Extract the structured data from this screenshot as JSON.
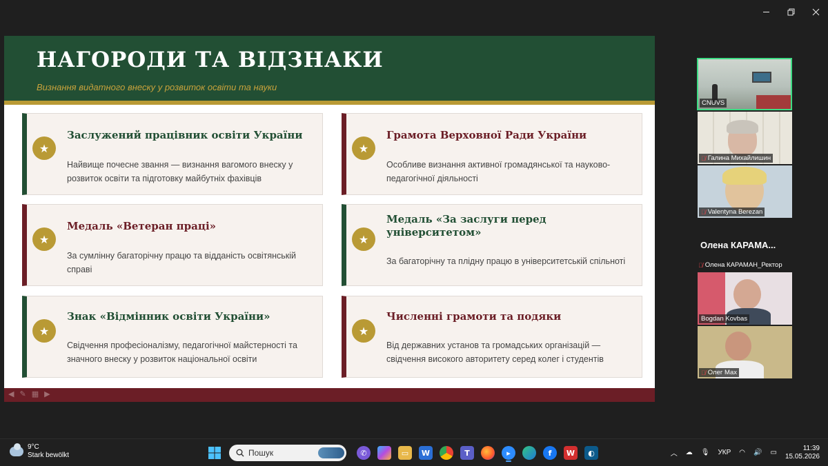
{
  "window": {
    "controls": [
      "minimize",
      "restore",
      "close"
    ]
  },
  "slide": {
    "title": "НАГОРОДИ ТА ВІДЗНАКИ",
    "subtitle": "Визнання видатного внеску у розвиток освіти та науки",
    "colors": {
      "green": "#224f34",
      "burgundy": "#6b1e26",
      "gold": "#b99a35",
      "card_bg": "#f7f2ee"
    },
    "cards": [
      {
        "title": "Заслужений працівник освіти України",
        "description": "Найвище почесне звання — визнання вагомого внеску у розвиток освіти та підготовку майбутніх фахівців",
        "accent": "green"
      },
      {
        "title": "Грамота Верховної Ради України",
        "description": "Особливе визнання активної громадянської та науково-педагогічної діяльності",
        "accent": "burgundy"
      },
      {
        "title": "Медаль «Ветеран праці»",
        "description": "За сумлінну багаторічну працю та відданість освітянській справі",
        "accent": "burgundy"
      },
      {
        "title": "Медаль «За заслуги перед університетом»",
        "description": "За багаторічну та плідну працю в університетській спільноті",
        "accent": "green"
      },
      {
        "title": "Знак «Відмінник освіти України»",
        "description": "Свідчення професіоналізму, педагогічної майстерності та значного внеску у розвиток національної освіти",
        "accent": "green"
      },
      {
        "title": "Численні грамоти та подяки",
        "description": "Від державних установ та громадських організацій — свідчення високого авторитету серед колег і студентів",
        "accent": "burgundy"
      }
    ]
  },
  "meeting": {
    "participants": [
      {
        "name": "CNUVS",
        "muted": false
      },
      {
        "name": "Галина Михайлишин",
        "muted": true
      },
      {
        "name": "Valentyna Berezan",
        "muted": true
      }
    ],
    "speaker_name": "Олена  КАРАМА...",
    "speaker_label": "Олена КАРАМАН_Ректор",
    "more_participants": [
      {
        "name": "Bogdan Kovbas",
        "muted": false
      },
      {
        "name": "Олег Мах",
        "muted": true
      }
    ]
  },
  "taskbar": {
    "weather_temp": "9°C",
    "weather_desc": "Stark bewölkt",
    "search_placeholder": "Пошук",
    "language": "УКР",
    "time": "11:39",
    "date": "15.05.2026"
  }
}
